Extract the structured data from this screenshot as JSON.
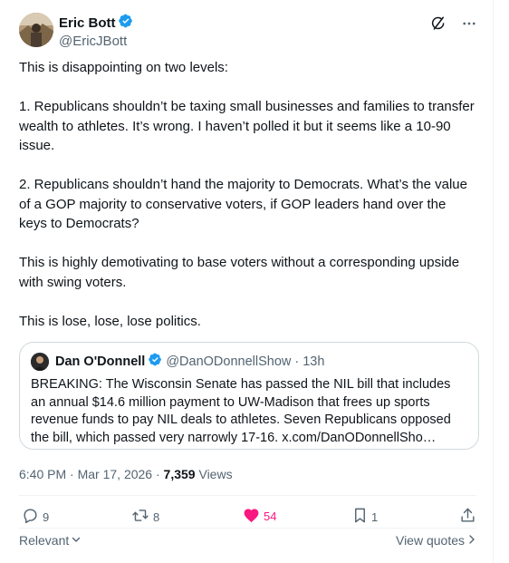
{
  "author": {
    "display_name": "Eric Bott",
    "handle": "@EricJBott",
    "verified": true
  },
  "header_icons": [
    "grok-icon",
    "more-icon"
  ],
  "tweet": {
    "paragraphs": [
      "This is disappointing on two levels:",
      "1. Republicans shouldn’t be taxing small businesses and families to transfer wealth to athletes. It’s wrong. I haven’t polled it but it seems like a 10-90 issue.",
      "2. Republicans shouldn’t hand the majority to Democrats. What’s the value of a GOP majority to conservative voters, if GOP leaders hand over the keys to Democrats?",
      "This is highly demotivating to base voters without a corresponding upside with swing voters.",
      "This is lose, lose, lose politics."
    ]
  },
  "quote": {
    "display_name": "Dan O'Donnell",
    "handle": "@DanODonnellShow",
    "separator": "·",
    "time": "13h",
    "text": "BREAKING: The Wisconsin Senate has passed the NIL bill that includes an annual $14.6 million payment to UW-Madison that frees up sports revenue funds to pay NIL deals to athletes. Seven Republicans opposed the bill, which passed very narrowly 17-16. x.com/DanODonnellSho…"
  },
  "meta": {
    "time": "6:40 PM",
    "separator": "·",
    "date": "Mar 17, 2026",
    "views_count": "7,359",
    "views_label": "Views"
  },
  "actions": {
    "replies": "9",
    "reposts": "8",
    "likes": "54",
    "bookmarks": "1"
  },
  "bottom": {
    "sort_label": "Relevant",
    "view_quotes": "View quotes"
  },
  "colors": {
    "verified_blue": "#1d9bf0",
    "like_pink": "#f91880",
    "secondary_text": "#536471"
  }
}
